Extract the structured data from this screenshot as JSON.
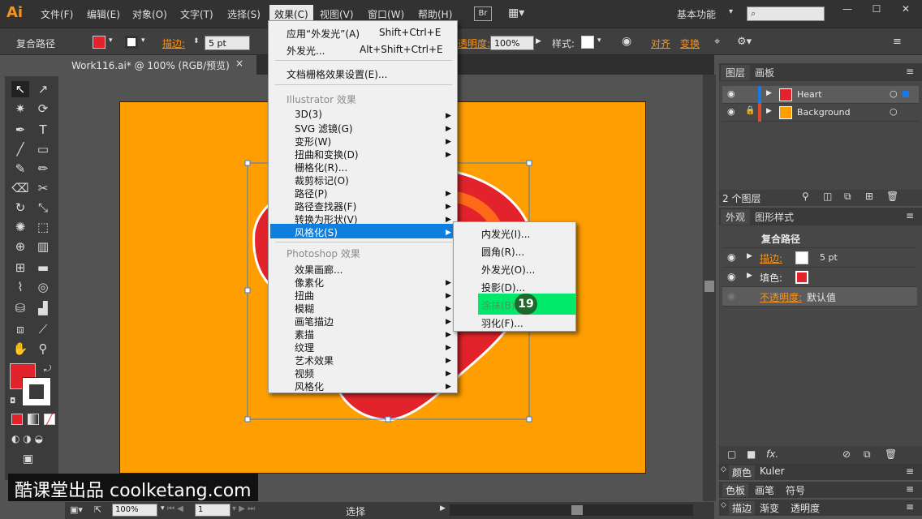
{
  "app": {
    "logo": "Ai",
    "menus": [
      "文件(F)",
      "编辑(E)",
      "对象(O)",
      "文字(T)",
      "选择(S)",
      "效果(C)",
      "视图(V)",
      "窗口(W)",
      "帮助(H)"
    ],
    "br_label": "Br",
    "workspace": "基本功能"
  },
  "control": {
    "object_type": "复合路径",
    "stroke_label": "描边:",
    "stroke_value": "5 pt",
    "opacity_label": "透明度:",
    "opacity_value": "100%",
    "style_label": "样式:",
    "align_label": "对齐",
    "transform_label": "变换"
  },
  "document": {
    "tab_title": "Work116.ai* @ 100% (RGB/预览)",
    "close_glyph": "×"
  },
  "effect_menu": {
    "apply_label": "应用“外发光”(A)",
    "apply_shortcut": "Shift+Ctrl+E",
    "last_label": "外发光...",
    "last_shortcut": "Alt+Shift+Ctrl+E",
    "raster_settings": "文档栅格效果设置(E)...",
    "illustrator_header": "Illustrator 效果",
    "illustrator_items": [
      "3D(3)",
      "SVG 滤镜(G)",
      "变形(W)",
      "扭曲和变换(D)",
      "栅格化(R)...",
      "裁剪标记(O)",
      "路径(P)",
      "路径查找器(F)",
      "转换为形状(V)",
      "风格化(S)"
    ],
    "photoshop_header": "Photoshop 效果",
    "photoshop_items": [
      "效果画廊...",
      "像素化",
      "扭曲",
      "模糊",
      "画笔描边",
      "素描",
      "纹理",
      "艺术效果",
      "视频",
      "风格化"
    ]
  },
  "submenu": {
    "items": [
      "内发光(I)...",
      "圆角(R)...",
      "外发光(O)...",
      "投影(D)...",
      "涂抹(B)...",
      "羽化(F)..."
    ],
    "step_badge": "19"
  },
  "layers_panel": {
    "tabs": [
      "图层",
      "画板"
    ],
    "layers": [
      {
        "name": "Heart",
        "color": "#1a78e0"
      },
      {
        "name": "Background",
        "color": "#e04a2a"
      }
    ],
    "count_label": "2 个图层"
  },
  "appearance_panel": {
    "tabs": [
      "外观",
      "图形样式"
    ],
    "object": "复合路径",
    "stroke_label": "描边:",
    "stroke_value": "5 pt",
    "fill_label": "填色:",
    "opacity_label": "不透明度:",
    "opacity_value": "默认值",
    "fx_label": "fx."
  },
  "bottom_panels": {
    "color_tabs": [
      "颜色",
      "Kuler"
    ],
    "swatch_tabs": [
      "色板",
      "画笔",
      "符号"
    ],
    "stroke_tabs": [
      "描边",
      "渐变",
      "透明度"
    ]
  },
  "status": {
    "zoom": "100%",
    "page": "1",
    "tool": "选择"
  },
  "watermark": "酷课堂出品 coolketang.com",
  "colors": {
    "artboard": "#fe9e00",
    "heart_red": "#e3232c",
    "accent_orange": "#f7941d",
    "menu_highlight": "#0e7fdf",
    "submenu_highlight": "#00e96b"
  }
}
